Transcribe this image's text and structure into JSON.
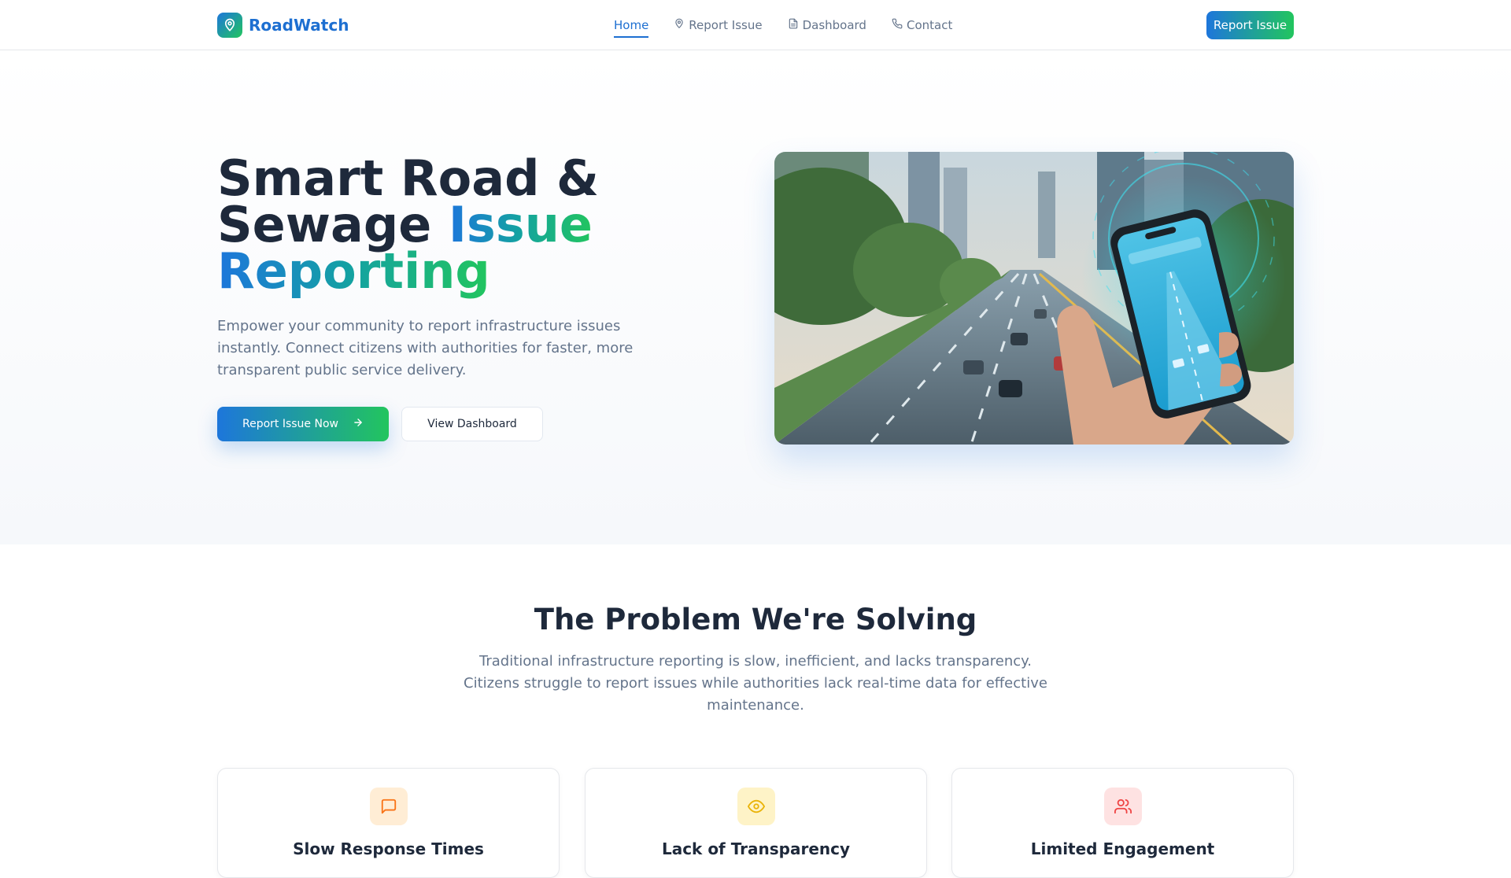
{
  "nav": {
    "brand": "RoadWatch",
    "links": [
      {
        "label": "Home",
        "icon": "none",
        "active": true
      },
      {
        "label": "Report Issue",
        "icon": "map-pin-icon",
        "active": false
      },
      {
        "label": "Dashboard",
        "icon": "document-icon",
        "active": false
      },
      {
        "label": "Contact",
        "icon": "phone-icon",
        "active": false
      }
    ],
    "cta_label": "Report Issue"
  },
  "hero": {
    "title_line1": "Smart Road &",
    "title_line2_plain": "Sewage ",
    "title_line2_accent": "Issue",
    "title_line3_accent": "Reporting",
    "subtitle": "Empower your community to report infrastructure issues instantly. Connect citizens with authorities for faster, more transparent public service delivery.",
    "primary_button": "Report Issue Now",
    "secondary_button": "View Dashboard"
  },
  "problem": {
    "title": "The Problem We're Solving",
    "subtitle": "Traditional infrastructure reporting is slow, inefficient, and lacks transparency. Citizens struggle to report issues while authorities lack real-time data for effective maintenance.",
    "cards": [
      {
        "title": "Slow Response Times",
        "icon": "message-square-icon",
        "color": "#f97316",
        "bg": "#ffedd5"
      },
      {
        "title": "Lack of Transparency",
        "icon": "eye-icon",
        "color": "#eab308",
        "bg": "#fef3c7"
      },
      {
        "title": "Limited Engagement",
        "icon": "users-icon",
        "color": "#ef4444",
        "bg": "#fee2e2"
      }
    ]
  },
  "colors": {
    "brand_blue": "#1d6fd1",
    "brand_green": "#22c55e",
    "text_dark": "#1e293b",
    "text_muted": "#64748b"
  }
}
